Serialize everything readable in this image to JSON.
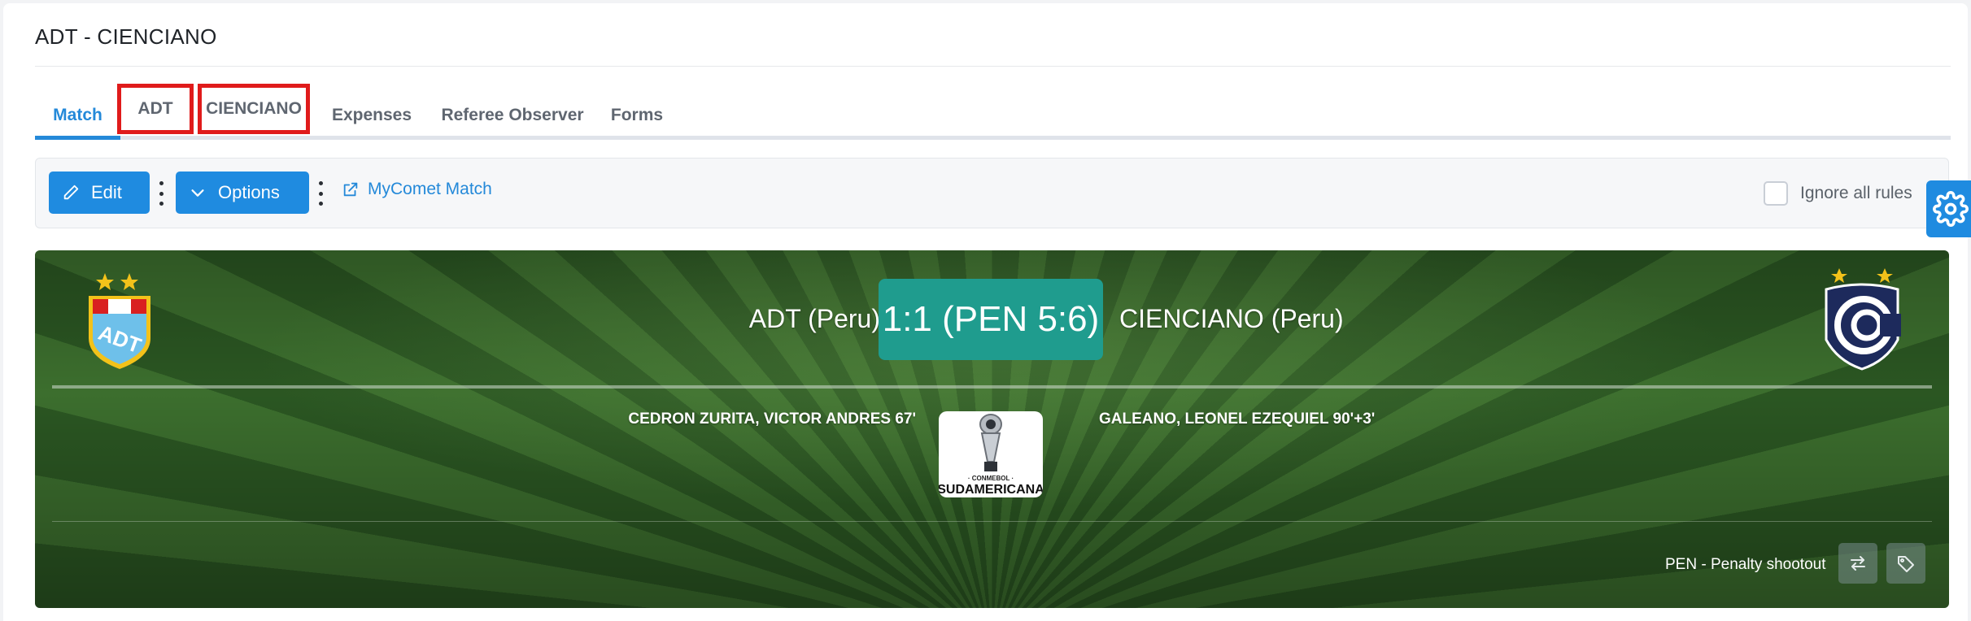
{
  "page": {
    "title": "ADT - CIENCIANO"
  },
  "tabs": [
    {
      "label": "Match",
      "active": true
    },
    {
      "label": "ADT",
      "highlighted": true
    },
    {
      "label": "CIENCIANO",
      "highlighted": true
    },
    {
      "label": "Expenses"
    },
    {
      "label": "Referee Observer"
    },
    {
      "label": "Forms"
    }
  ],
  "toolbar": {
    "edit_label": "Edit",
    "options_label": "Options",
    "mycomet_label": "MyComet Match",
    "ignore_rules_label": "Ignore all rules",
    "ignore_rules_checked": false
  },
  "match": {
    "home_team": "ADT (Peru)",
    "away_team": "CIENCIANO (Peru)",
    "score": "1:1 (PEN 5:6)",
    "home_scorer": "CEDRON ZURITA, VICTOR ANDRES 67'",
    "away_scorer": "GALEANO, LEONEL EZEQUIEL 90'+3'",
    "competition_small": "· CONMEBOL ·",
    "competition_name": "SUDAMERICANA",
    "home_crest_text": "ADT",
    "penalty_note": "PEN - Penalty shootout"
  },
  "colors": {
    "accent": "#1f8be0",
    "score_bg": "#1f9c8e",
    "tab_highlight": "#e01b1b"
  },
  "icons": [
    "pencil-icon",
    "chevron-down-icon",
    "external-link-icon",
    "gear-icon",
    "swap-icon",
    "tag-icon"
  ]
}
